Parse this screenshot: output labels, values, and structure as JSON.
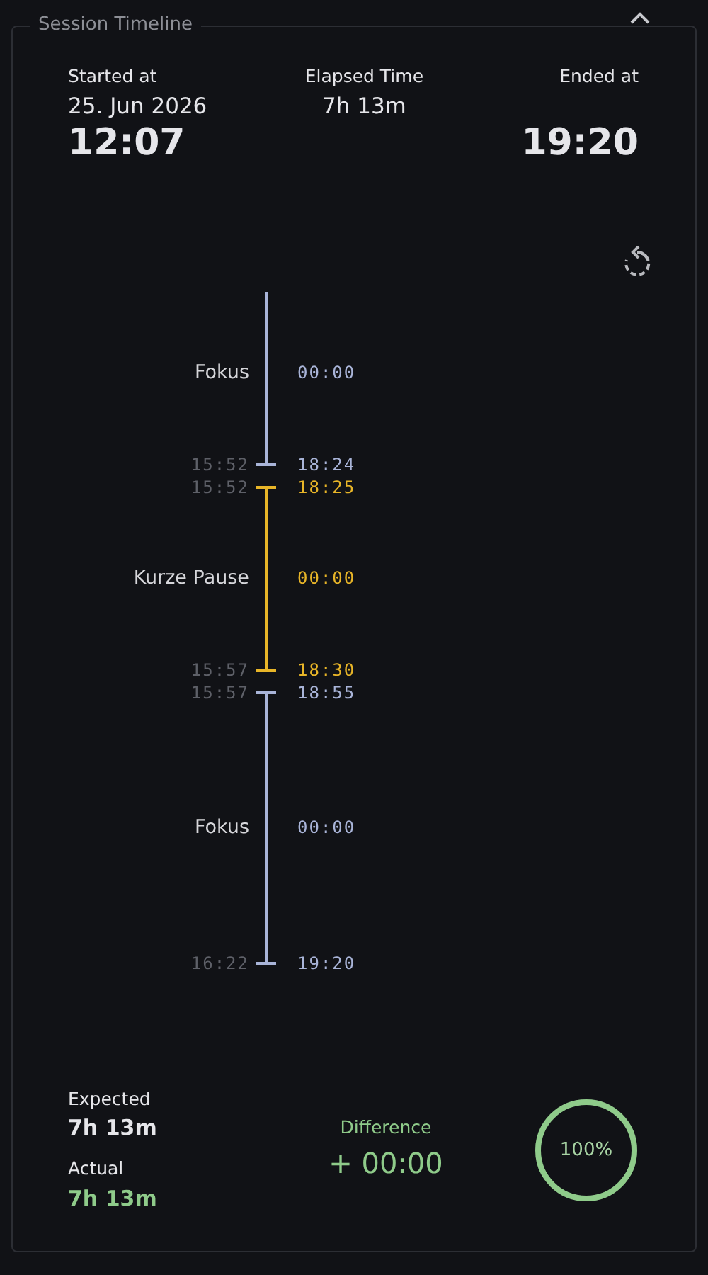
{
  "panel": {
    "title": "Session Timeline",
    "expanded": true
  },
  "summary": {
    "started_label": "Started at",
    "started_date": "25. Jun 2026",
    "started_time": "12:07",
    "elapsed_label": "Elapsed Time",
    "elapsed_value": "7h 13m",
    "ended_label": "Ended at",
    "ended_time": "19:20"
  },
  "timeline": [
    {
      "label": "Fokus",
      "duration": "00:00",
      "color": "#a9b4d8",
      "end_left": "15:52",
      "end_right": "18:24"
    },
    {
      "label": "Kurze Pause",
      "duration": "00:00",
      "color": "#e8b528",
      "start_left": "15:52",
      "start_right": "18:25",
      "end_left": "15:57",
      "end_right": "18:30"
    },
    {
      "label": "Fokus",
      "duration": "00:00",
      "color": "#a9b4d8",
      "start_left": "15:57",
      "start_right": "18:55",
      "end_left": "16:22",
      "end_right": "19:20"
    }
  ],
  "totals": {
    "expected_label": "Expected",
    "expected_value": "7h 13m",
    "actual_label": "Actual",
    "actual_value": "7h 13m",
    "difference_label": "Difference",
    "difference_value": "+ 00:00",
    "completion": "100%"
  }
}
